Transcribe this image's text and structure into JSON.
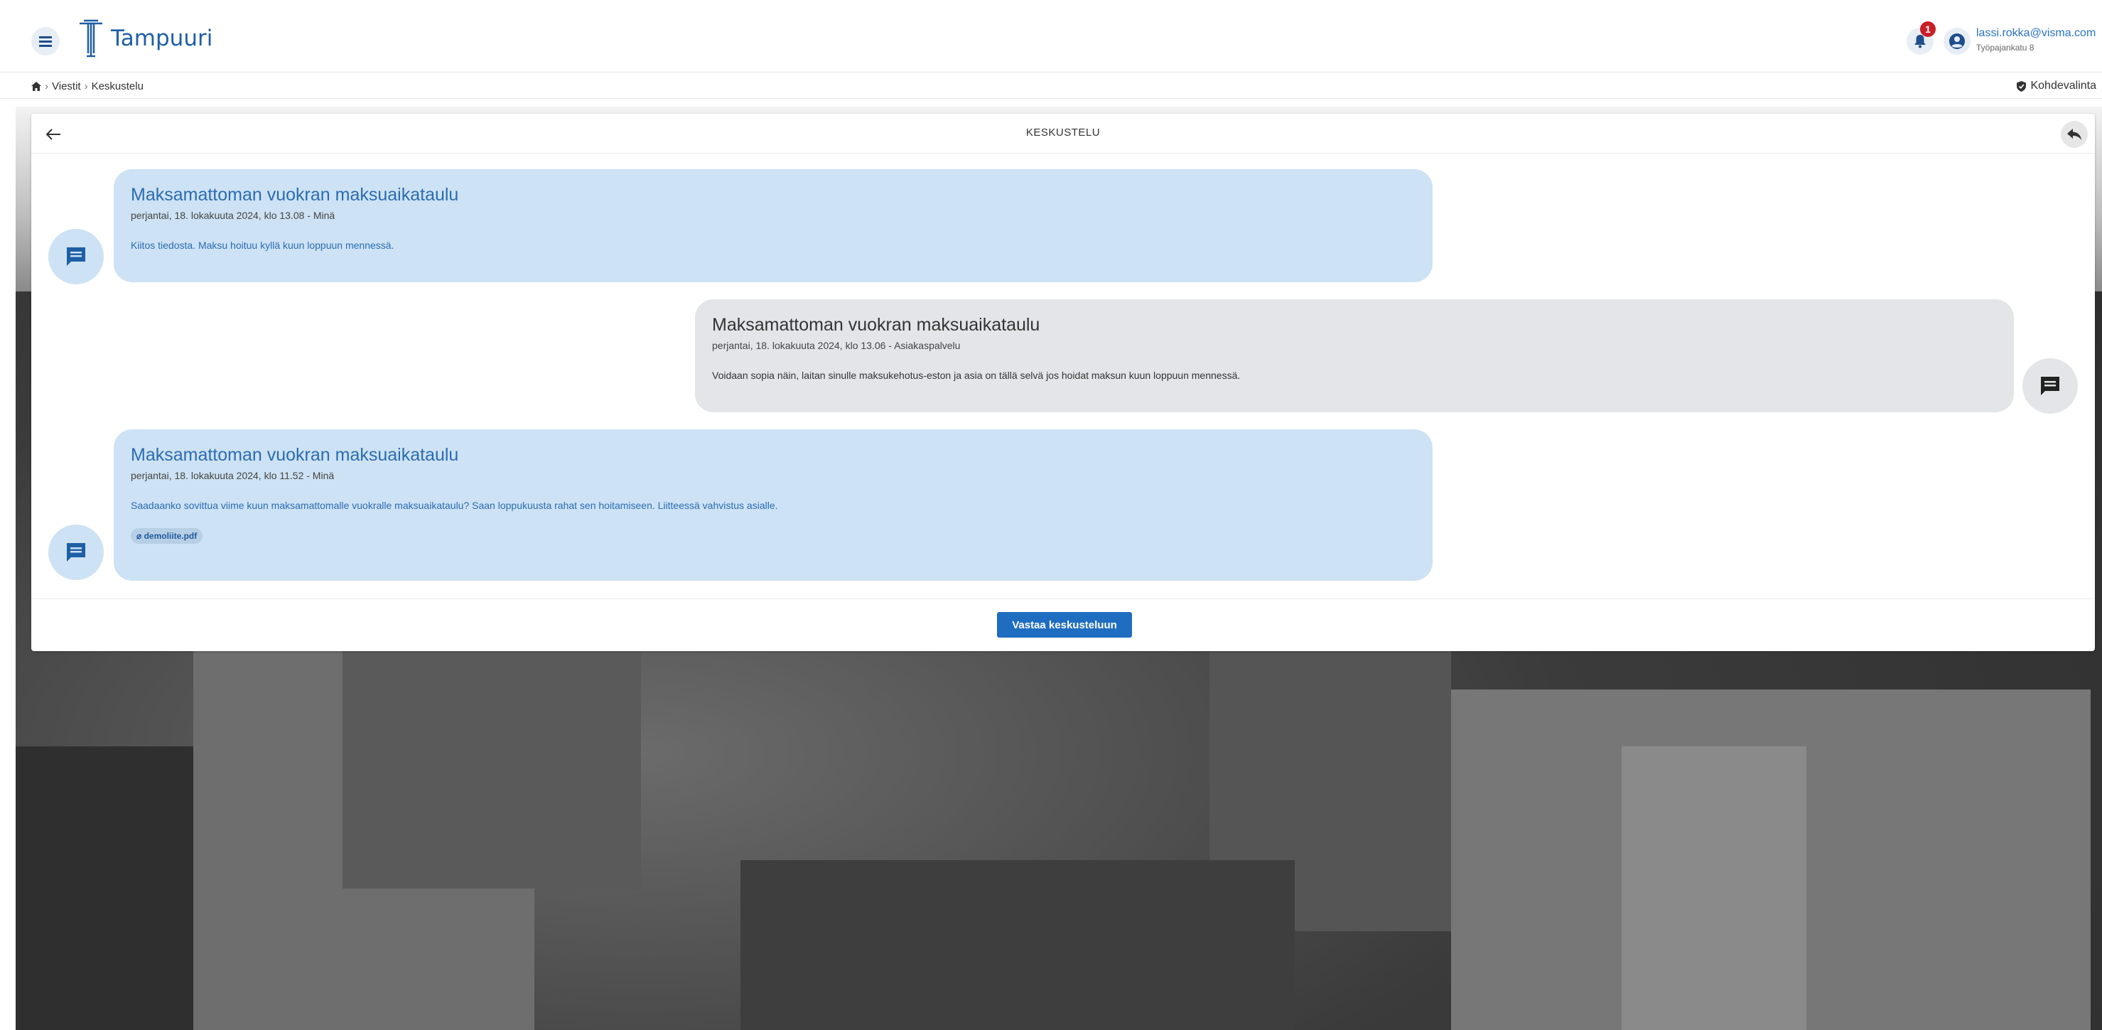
{
  "header": {
    "app_name": "Tampuuri",
    "notification_count": "1",
    "user_email": "lassi.rokka@visma.com",
    "user_address": "Työpajankatu 8"
  },
  "breadcrumb": {
    "items": [
      "Viestit",
      "Keskustelu"
    ],
    "separator": "›",
    "target_label": "Kohdevalinta"
  },
  "panel": {
    "title": "KESKUSTELU"
  },
  "messages": [
    {
      "title": "Maksamattoman vuokran maksuaikataulu",
      "meta": "perjantai, 18. lokakuuta 2024, klo 13.08 -  Minä",
      "body": "Kiitos tiedosta. Maksu hoituu kyllä kuun loppuun mennessä."
    },
    {
      "title": "Maksamattoman vuokran maksuaikataulu",
      "meta": "perjantai, 18. lokakuuta 2024, klo 13.06 -  Asiakaspalvelu",
      "body": "Voidaan sopia näin, laitan sinulle maksukehotus-eston ja asia on tällä selvä jos hoidat maksun kuun loppuun mennessä."
    },
    {
      "title": "Maksamattoman vuokran maksuaikataulu",
      "meta": "perjantai, 18. lokakuuta 2024, klo 11.52 -  Minä",
      "body": "Saadaanko sovittua viime kuun maksamattomalle vuokralle maksuaikataulu? Saan loppukuusta rahat sen hoitamiseen. Liitteessä vahvistus asialle.",
      "attachment": "demoliite.pdf"
    }
  ],
  "footer": {
    "reply_label": "Vastaa keskusteluun"
  },
  "colors": {
    "brand_blue": "#1e5fa6",
    "own_message_bg": "#cde2f4",
    "other_message_bg": "#e3e5e8",
    "button_blue": "#1f6dc0",
    "badge_red": "#c8202a"
  },
  "icons": {
    "menu": "hamburger-icon",
    "notifications": "bell-icon",
    "user": "user-circle-icon",
    "home": "home-icon",
    "target": "shield-check-icon",
    "back": "arrow-left-icon",
    "reply": "reply-icon",
    "message": "chat-bubble-icon",
    "attachment": "paperclip-icon"
  }
}
